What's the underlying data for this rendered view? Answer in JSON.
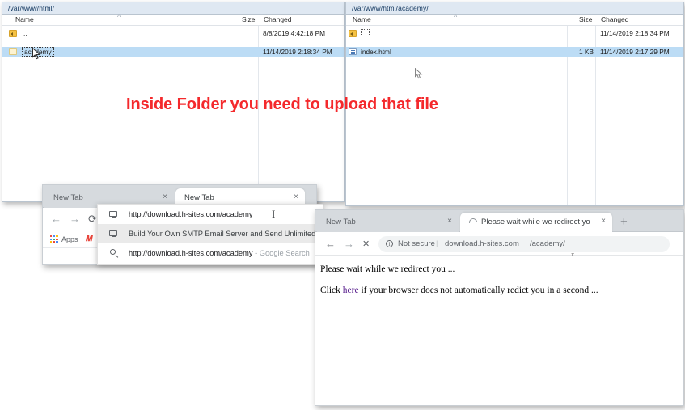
{
  "callout": {
    "text": "Inside Folder you need to upload that file",
    "color": "#f4292c"
  },
  "file_manager_left": {
    "path": "/var/www/html/",
    "columns": {
      "name": "Name",
      "size": "Size",
      "changed": "Changed"
    },
    "sort_indicator": "^",
    "rows": [
      {
        "icon": "parent-folder-icon",
        "name": "..",
        "size": "",
        "changed": "8/8/2019 4:42:18 PM",
        "selected": false
      },
      {
        "icon": "folder-icon",
        "name": "academy",
        "size": "",
        "changed": "11/14/2019 2:18:34 PM",
        "selected": true
      }
    ]
  },
  "file_manager_right": {
    "path": "/var/www/html/academy/",
    "columns": {
      "name": "Name",
      "size": "Size",
      "changed": "Changed"
    },
    "sort_indicator": "^",
    "rows": [
      {
        "icon": "parent-folder-icon",
        "name": "",
        "size": "",
        "changed": "11/14/2019 2:18:34 PM",
        "selected": false
      },
      {
        "icon": "html-file-icon",
        "name": "index.html",
        "size": "1 KB",
        "changed": "11/14/2019 2:17:29 PM",
        "selected": true
      }
    ]
  },
  "browser_back": {
    "tabs": [
      {
        "label": "New Tab",
        "close": "×",
        "active": false
      },
      {
        "label": "New Tab",
        "close": "×",
        "active": true
      }
    ],
    "new_tab_label": "+",
    "nav": {
      "back": "←",
      "forward": "→",
      "reload": "⟳"
    },
    "omnibox_value": "http://download.h-sites.com/academy",
    "omnibox_domain": "http://download.h-sites.com",
    "omnibox_path": "/academy",
    "bookmarks": [
      {
        "label": "Apps",
        "icon": "apps-grid-icon"
      },
      {
        "label": "",
        "icon": "red-m-icon"
      }
    ],
    "autocomplete": [
      {
        "icon": "monitor-icon",
        "text": "http://download.h-sites.com/academy",
        "text_dim": "",
        "highlighted": false
      },
      {
        "icon": "monitor-icon",
        "text": "Build Your Own SMTP Email Server and Send Unlimited ",
        "text_dim": "",
        "highlighted": true
      },
      {
        "icon": "search-icon",
        "text": "http://download.h-sites.com/academy",
        "text_dim": " - Google Search",
        "highlighted": false
      }
    ]
  },
  "browser_front": {
    "tabs": [
      {
        "label": "New Tab",
        "close": "×",
        "active": false,
        "loading": false
      },
      {
        "label": "Please wait while we redirect you",
        "close": "×",
        "active": true,
        "loading": true
      }
    ],
    "new_tab_label": "+",
    "nav": {
      "back": "←",
      "forward": "→",
      "stop": "✕"
    },
    "security": {
      "icon": "info-circle-icon",
      "glyph": "i",
      "label": "Not secure",
      "divider": "|"
    },
    "url_domain": "download.h-sites.com",
    "url_path": "/academy/",
    "page": {
      "line1": "Please wait while we redirect you ...",
      "line2_before": "Click ",
      "line2_link": "here",
      "line2_after": " if your browser does not automatically redict you in a second ..."
    }
  }
}
